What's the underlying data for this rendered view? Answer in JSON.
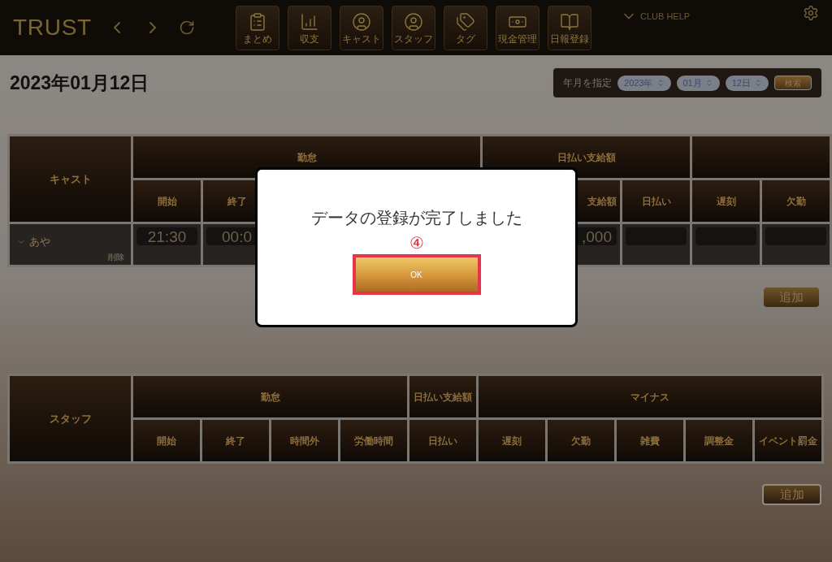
{
  "app": {
    "logo": "TRUST",
    "toolbar": [
      {
        "label": "まとめ"
      },
      {
        "label": "収支"
      },
      {
        "label": "キャスト"
      },
      {
        "label": "スタッフ"
      },
      {
        "label": "タグ"
      },
      {
        "label": "現金管理"
      },
      {
        "label": "日報登録"
      }
    ],
    "help": "CLUB HELP"
  },
  "date_title": "2023年01月12日",
  "date_picker": {
    "label": "年月を指定",
    "year": "2023年",
    "month": "01月",
    "day": "12日",
    "search": "検索"
  },
  "cast_table": {
    "corner": "キャスト",
    "groups": [
      {
        "label": "勤怠",
        "columns": [
          "開始",
          "終了",
          null,
          null,
          null
        ]
      },
      {
        "label": "日払い支給額",
        "columns": [
          null,
          "支給額",
          "日払い"
        ]
      },
      {
        "columns": [
          "遅刻",
          "欠勤"
        ]
      }
    ],
    "rows": [
      {
        "name": "あや",
        "expanded": false,
        "delete": "削除",
        "cells": [
          "21:30",
          "00:0",
          null,
          null,
          null,
          null,
          ",000",
          null,
          null,
          null
        ]
      }
    ],
    "add": "追加"
  },
  "staff_table": {
    "corner": "スタッフ",
    "groups": [
      {
        "label": "勤怠",
        "columns": [
          "開始",
          "終了",
          "時間外",
          "労働時間"
        ]
      },
      {
        "label": "日払い支給額",
        "columns": [
          "日払い"
        ]
      },
      {
        "label": "マイナス",
        "columns": [
          "遅刻",
          "欠勤",
          "雑費",
          "調整金",
          "イベント罰金"
        ]
      }
    ],
    "add": "追加"
  },
  "dialog": {
    "message": "データの登録が完了しました",
    "step": "④",
    "ok": "OK"
  }
}
